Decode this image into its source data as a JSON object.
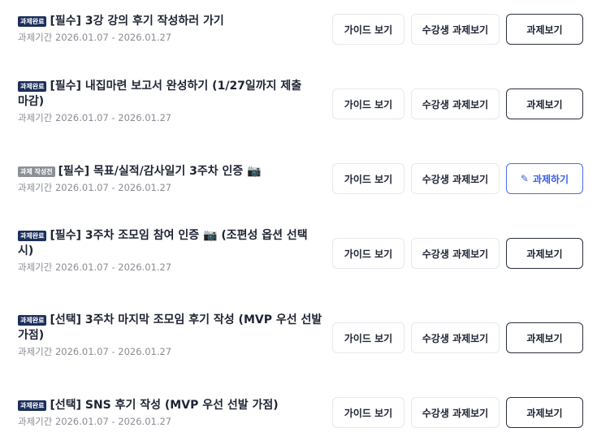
{
  "period_prefix": "과제기간",
  "buttons": {
    "guide": "가이드 보기",
    "peers": "수강생 과제보기",
    "view": "과제보기",
    "do": "과제하기"
  },
  "badges": {
    "done": "과제완료",
    "writing": "과제 작성전"
  },
  "tasks": [
    {
      "badge": "과제완료",
      "title": "[필수] 3강 강의 후기 작성하러 가기",
      "period": "과제기간 2026.01.07 - 2026.01.27",
      "action": "과제보기"
    },
    {
      "badge": "과제완료",
      "title": "[필수] 내집마련 보고서 완성하기 (1/27일까지 제출 마감)",
      "period": "과제기간 2026.01.07 - 2026.01.27",
      "action": "과제보기"
    },
    {
      "badge": "과제 작성전",
      "title": "[필수] 목표/실적/감사일기 3주차 인증 📷",
      "period": "과제기간 2026.01.07 - 2026.01.27",
      "action": "과제하기"
    },
    {
      "badge": "과제완료",
      "title": "[필수] 3주차 조모임 참여 인증 📷 (조편성 옵션 선택 시)",
      "period": "과제기간 2026.01.07 - 2026.01.27",
      "action": "과제보기"
    },
    {
      "badge": "과제완료",
      "title": "[선택] 3주차 마지막 조모임 후기 작성 (MVP 우선 선발 가점)",
      "period": "과제기간 2026.01.07 - 2026.01.27",
      "action": "과제보기"
    },
    {
      "badge": "과제완료",
      "title": "[선택] SNS 후기 작성 (MVP 우선 선발 가점)",
      "period": "과제기간 2026.01.07 - 2026.01.27",
      "action": "과제보기"
    }
  ]
}
